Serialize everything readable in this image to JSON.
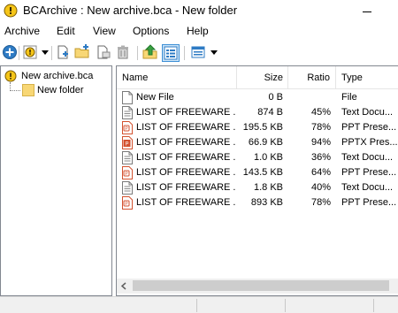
{
  "window": {
    "title": "BCArchive : New archive.bca - New folder"
  },
  "menu": [
    "Archive",
    "Edit",
    "View",
    "Options",
    "Help"
  ],
  "tree": {
    "root_label": "New archive.bca",
    "child_label": "New folder"
  },
  "list": {
    "columns": [
      "Name",
      "Size",
      "Ratio",
      "Type"
    ],
    "rows": [
      {
        "name": "New File",
        "size": "0 B",
        "ratio": "",
        "type": "File",
        "icon": "blank-file-icon"
      },
      {
        "name": "LIST OF FREEWARE ...",
        "size": "874 B",
        "ratio": "45%",
        "type": "Text Docu...",
        "icon": "text-file-icon"
      },
      {
        "name": "LIST OF FREEWARE ...",
        "size": "195.5 KB",
        "ratio": "78%",
        "type": "PPT Prese...",
        "icon": "ppt-file-icon"
      },
      {
        "name": "LIST OF FREEWARE ...",
        "size": "66.9 KB",
        "ratio": "94%",
        "type": "PPTX Pres...",
        "icon": "pptx-file-icon"
      },
      {
        "name": "LIST OF FREEWARE ...",
        "size": "1.0 KB",
        "ratio": "36%",
        "type": "Text Docu...",
        "icon": "text-file-icon"
      },
      {
        "name": "LIST OF FREEWARE ...",
        "size": "143.5 KB",
        "ratio": "64%",
        "type": "PPT Prese...",
        "icon": "ppt-file-icon"
      },
      {
        "name": "LIST OF FREEWARE ...",
        "size": "1.8 KB",
        "ratio": "40%",
        "type": "Text Docu...",
        "icon": "text-file-icon"
      },
      {
        "name": "LIST OF FREEWARE ...",
        "size": "893 KB",
        "ratio": "78%",
        "type": "PPT Prese...",
        "icon": "ppt-file-icon"
      }
    ]
  },
  "colors": {
    "ppt_orange": "#d35230",
    "folder_yellow": "#f8d775",
    "selection_blue": "#cce4f7",
    "arrow_green": "#3aa142"
  }
}
